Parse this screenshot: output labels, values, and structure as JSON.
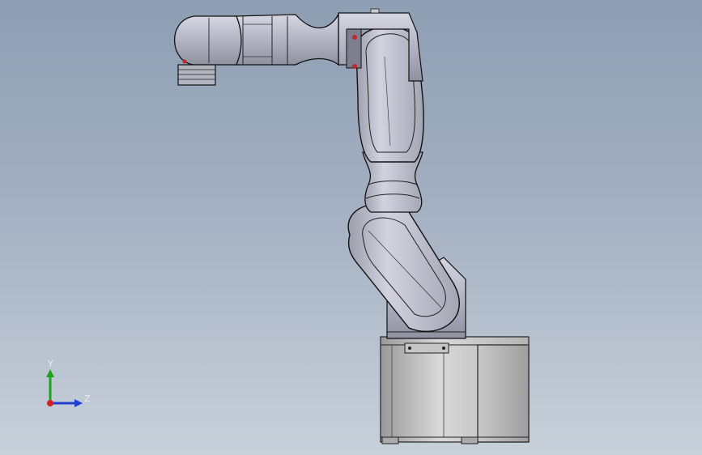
{
  "viewport": {
    "background_top": "#8e9eb3",
    "background_bottom": "#c8d0da"
  },
  "model": {
    "parts": [
      "base-cabinet",
      "base-joint",
      "lower-arm",
      "elbow-joint",
      "upper-arm",
      "shoulder-housing",
      "forearm",
      "wrist",
      "end-flange"
    ],
    "colors": {
      "body": "#b8b9c8",
      "body_dark": "#8d8e9e",
      "edge": "#1a1a22",
      "cabinet": "#bcbcbc",
      "accent_red": "#c0282a"
    }
  },
  "triad": {
    "y_label": "Y",
    "z_label": "Z",
    "x_color": "#d42020",
    "y_color": "#1fa01f",
    "z_color": "#1f3fd0"
  }
}
